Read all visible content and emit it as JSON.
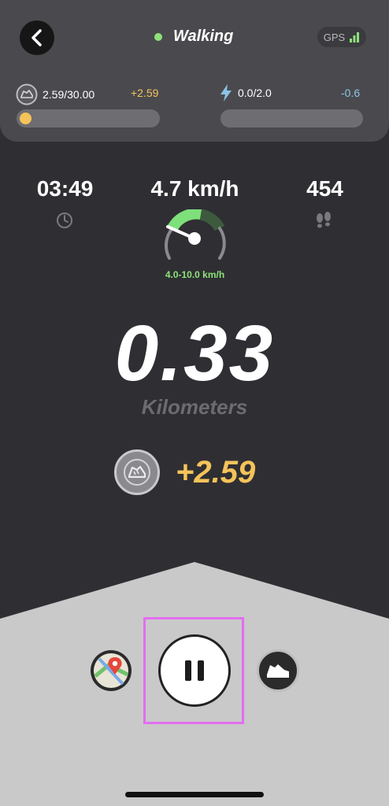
{
  "header": {
    "mode_label": "Walking",
    "mode_status_color": "#8ee27a",
    "gps_label": "GPS",
    "back_icon": "chevron-left-icon"
  },
  "energy": {
    "left_value": "2.59/30.00",
    "left_delta": "+2.59",
    "left_progress": 0.086,
    "right_value": "0.0/2.0",
    "right_delta": "-0.6",
    "right_progress": 0
  },
  "stats": {
    "time": "03:49",
    "speed": "4.7 km/h",
    "steps": "454",
    "speed_range": "4.0-10.0 km/h"
  },
  "distance": {
    "value": "0.33",
    "unit": "Kilometers"
  },
  "earnings": {
    "value": "+2.59"
  },
  "colors": {
    "accent_gold": "#f5c35a",
    "accent_green": "#8ee27a",
    "accent_blue": "#8cc4e6",
    "highlight": "#e36ef0"
  }
}
